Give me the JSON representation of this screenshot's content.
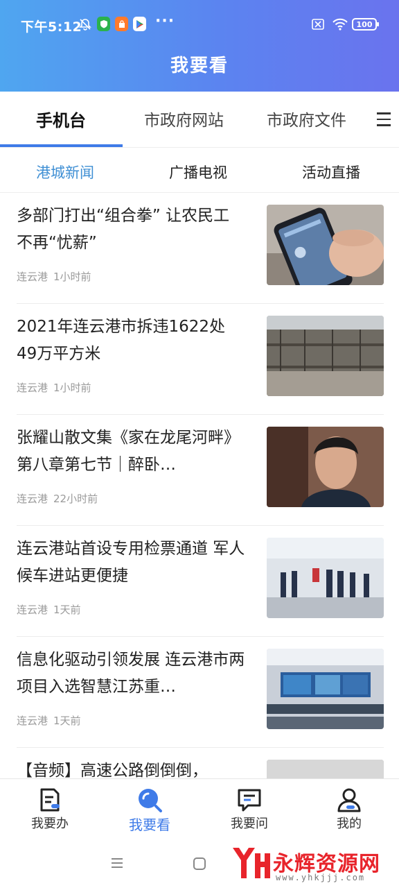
{
  "status_bar": {
    "time": "下午5:12",
    "more": "···",
    "battery": "100"
  },
  "header": {
    "title": "我要看"
  },
  "tabs": [
    {
      "label": "手机台",
      "active": true
    },
    {
      "label": "市政府网站",
      "active": false
    },
    {
      "label": "市政府文件",
      "active": false
    }
  ],
  "subtabs": [
    {
      "label": "港城新闻",
      "active": true
    },
    {
      "label": "广播电视",
      "active": false
    },
    {
      "label": "活动直播",
      "active": false
    }
  ],
  "news": [
    {
      "title": "多部门打出“组合拳” 让农民工不再“忧薪”",
      "source": "连云港",
      "time": "1小时前"
    },
    {
      "title": "2021年连云港市拆违1622处49万平方米",
      "source": "连云港",
      "time": "1小时前"
    },
    {
      "title": "张耀山散文集《家在龙尾河畔》第八章第七节｜醉卧…",
      "source": "连云港",
      "time": "22小时前"
    },
    {
      "title": "连云港站首设专用检票通道 军人候车进站更便捷",
      "source": "连云港",
      "time": "1天前"
    },
    {
      "title": "信息化驱动引领发展 连云港市两项目入选智慧江苏重…",
      "source": "连云港",
      "time": "1天前"
    },
    {
      "title": "【音频】高速公路倒倒倒，",
      "source": "",
      "time": ""
    }
  ],
  "bottom_nav": [
    {
      "label": "我要办",
      "icon": "document-icon",
      "active": false
    },
    {
      "label": "我要看",
      "icon": "search-icon",
      "active": true
    },
    {
      "label": "我要问",
      "icon": "chat-icon",
      "active": false
    },
    {
      "label": "我的",
      "icon": "user-icon",
      "active": false
    }
  ],
  "watermark": {
    "text": "永辉资源网",
    "url": "www.yhkjjj.com"
  },
  "colors": {
    "accent": "#3f7be8",
    "subtab_active": "#3f8fd4",
    "header_start": "#4fa6f0",
    "header_end": "#6a73ee",
    "watermark": "#e8242b"
  }
}
